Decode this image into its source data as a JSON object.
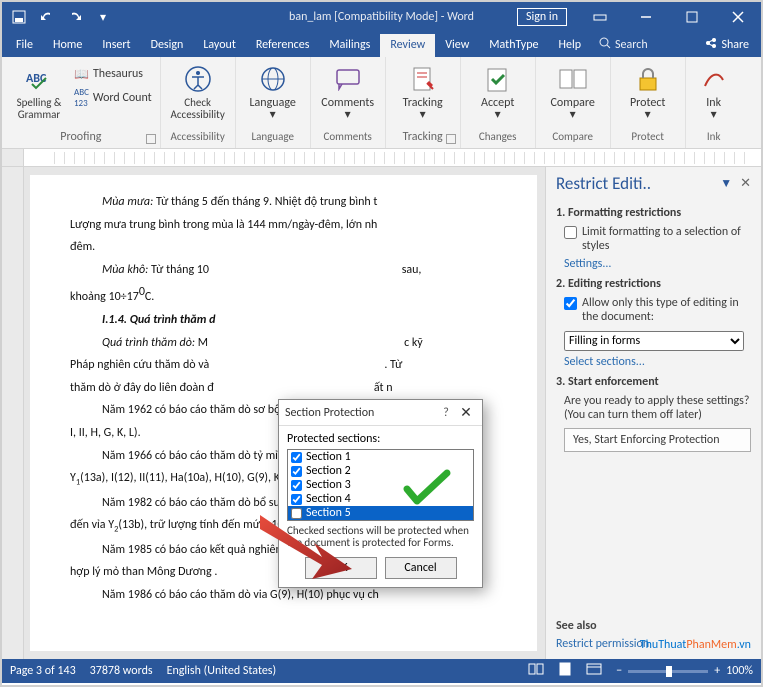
{
  "titlebar": {
    "title": "ban_lam [Compatibility Mode] - Word",
    "signin": "Sign in"
  },
  "tabs": {
    "file": "File",
    "home": "Home",
    "insert": "Insert",
    "design": "Design",
    "layout": "Layout",
    "references": "References",
    "mailings": "Mailings",
    "review": "Review",
    "view": "View",
    "mathtype": "MathType",
    "help": "Help",
    "tellme": "Search",
    "share": "Share"
  },
  "ribbon": {
    "proofing": {
      "label": "Proofing",
      "spelling": "Spelling &\nGrammar",
      "thesaurus": "Thesaurus",
      "wordcount": "Word Count"
    },
    "accessibility": {
      "label": "Accessibility",
      "check": "Check\nAccessibility"
    },
    "language": {
      "label": "Language",
      "btn": "Language"
    },
    "comments": {
      "label": "Comments",
      "btn": "Comments"
    },
    "tracking": {
      "label": "Tracking",
      "btn": "Tracking"
    },
    "changes": {
      "label": "Changes",
      "btn": "Accept"
    },
    "compare": {
      "label": "Compare",
      "btn": "Compare"
    },
    "protect": {
      "label": "Protect",
      "btn": "Protect"
    },
    "ink": {
      "label": "Ink",
      "btn": "Ink"
    }
  },
  "document": {
    "p1a": "Mùa mưa:",
    "p1b": " Từ tháng 5 đến tháng 9. Nhiệt độ trung bình t",
    "p2": "Lượng mưa trung bình trong mùa là 144 mm/ngày-đêm, lớn nh",
    "p2b": "đêm.",
    "p3a": "Mùa khô:",
    "p3b": " Từ tháng 10 ",
    "p3c": "sau, ",
    "p4": "khoảng 10÷17",
    "p4b": "0",
    "p4c": "C.",
    "h": "I.1.4. Quá trình thăm d",
    "p5a": "Quá trình thăm dò:",
    "p5b": " M",
    "p5c": "c kỹ ",
    "p6": "Pháp nghiên cứu thăm dò và",
    "p6b": ". Từ ",
    "p7": "thăm dò ở đây do liên đoàn đ",
    "p7b": "ất n",
    "p8": "Năm 1962 có báo cáo thăm dò sơ bộ và tính trữ lượng cù",
    "p9": "I, II, H, G, K, L).",
    "p10": "Năm 1966 có báo cáo thăm dò tỷ mỉ và tính trữ lượng 8",
    "p11": "Y",
    "p11s": "1",
    "p11b": "(13a), I(12), II(11), Ha(10a), H(10), G(9), K(8).",
    "p12": "Năm 1982 có báo cáo thăm dò bổ sung và tính trữ lượng 8",
    "p13": "đến vỉa Y",
    "p13s": "2",
    "p13b": "(13b), trữ lượng tính đến mức -100.",
    "p14": "Năm 1985 có báo cáo kết quả nghiên cứu đề tài : Xác định",
    "p15": "hợp lý mỏ than Mông Dương .",
    "p16": "Năm 1986 có báo cáo thăm dò via G(9), H(10) phục vụ ch"
  },
  "dialog": {
    "title": "Section Protection",
    "label": "Protected sections:",
    "sections": [
      "Section 1",
      "Section 2",
      "Section 3",
      "Section 4",
      "Section 5"
    ],
    "hint": "Checked sections will be protected when the document is protected for Forms.",
    "ok": "OK",
    "cancel": "Cancel"
  },
  "pane": {
    "title": "Restrict Editi..",
    "s1": "1. Formatting restrictions",
    "s1chk": "Limit formatting to a selection of styles",
    "s1link": "Settings...",
    "s2": "2. Editing restrictions",
    "s2chk": "Allow only this type of editing in the document:",
    "s2sel": "Filling in forms",
    "s2link": "Select sections...",
    "s3": "3. Start enforcement",
    "s3hint": "Are you ready to apply these settings? (You can turn them off later)",
    "s3btn": "Yes, Start Enforcing Protection",
    "seealso": "See also",
    "perm": "Restrict permission"
  },
  "statusbar": {
    "page": "Page 3 of 143",
    "words": "37878 words",
    "lang": "English (United States)",
    "zoom": "100%"
  },
  "watermark": {
    "a": "ThuThuat",
    "b": "PhanMem",
    "c": ".vn"
  }
}
